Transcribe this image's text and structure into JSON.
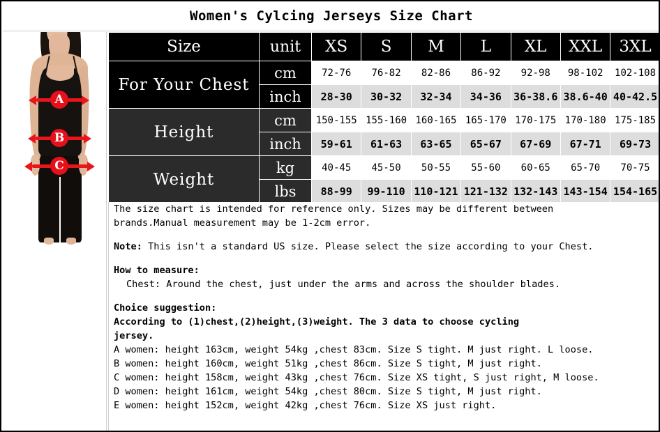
{
  "title": "Women's Cylcing Jerseys Size Chart",
  "photo": {
    "alt_name": "woman-measurement-photo",
    "markers": [
      {
        "letter": "A",
        "meaning": "chest"
      },
      {
        "letter": "B",
        "meaning": "waist"
      },
      {
        "letter": "C",
        "meaning": "hip"
      }
    ]
  },
  "table": {
    "header": {
      "label": "Size",
      "unit": "unit",
      "sizes": [
        "XS",
        "S",
        "M",
        "L",
        "XL",
        "XXL",
        "3XL"
      ]
    },
    "groups": [
      {
        "label": "For Your Chest",
        "rows": [
          {
            "unit": "cm",
            "values": [
              "72-76",
              "76-82",
              "82-86",
              "86-92",
              "92-98",
              "98-102",
              "102-108"
            ]
          },
          {
            "unit": "inch",
            "values": [
              "28-30",
              "30-32",
              "32-34",
              "34-36",
              "36-38.6",
              "38.6-40",
              "40-42.5"
            ]
          }
        ]
      },
      {
        "label": "Height",
        "rows": [
          {
            "unit": "cm",
            "values": [
              "150-155",
              "155-160",
              "160-165",
              "165-170",
              "170-175",
              "170-180",
              "175-185"
            ]
          },
          {
            "unit": "inch",
            "values": [
              "59-61",
              "61-63",
              "63-65",
              "65-67",
              "67-69",
              "67-71",
              "69-73"
            ]
          }
        ]
      },
      {
        "label": "Weight",
        "rows": [
          {
            "unit": "kg",
            "values": [
              "40-45",
              "45-50",
              "50-55",
              "55-60",
              "60-65",
              "65-70",
              "70-75"
            ]
          },
          {
            "unit": "lbs",
            "values": [
              "88-99",
              "99-110",
              "110-121",
              "121-132",
              "132-143",
              "143-154",
              "154-165"
            ]
          }
        ]
      }
    ]
  },
  "notes": {
    "disclaimer_line1": "The size chart is intended for reference only. Sizes may be different between",
    "disclaimer_line2": "brands.Manual measurement may be 1-2cm error.",
    "note_label": "Note:",
    "note_text": " This isn't a standard US size. Please select the size according to your Chest.",
    "how_to_measure_heading": "How to measure:",
    "how_to_measure_chest": "Chest: Around the chest, just under the arms and across the shoulder blades.",
    "choice_heading": "Choice suggestion:",
    "choice_line1": "According to (1)chest,(2)height,(3)weight. The 3 data to choose cycling",
    "choice_line2": "jersey.",
    "examples": [
      "A women: height 163cm, weight 54kg ,chest 83cm. Size S tight. M just right. L loose.",
      "B women: height 160cm, weight 51kg ,chest 86cm. Size S tight, M just right.",
      "C women: height 158cm, weight 43kg ,chest 76cm. Size XS tight, S just right, M loose.",
      "D women: height 161cm, weight 54kg ,chest 80cm. Size S tight, M just right.",
      "E women: height 152cm, weight 42kg ,chest 76cm. Size XS just right."
    ]
  },
  "colors": {
    "header_black": "#000000",
    "label_gray": "#2b2b2b",
    "alt_row": "#dddddd",
    "marker_red": "#e5101a",
    "page_bg": "#ffffff"
  }
}
